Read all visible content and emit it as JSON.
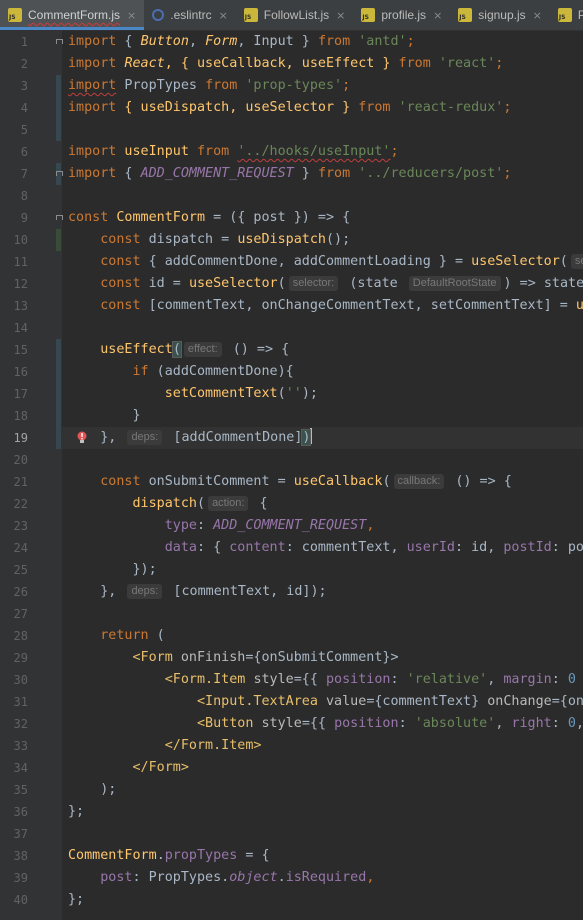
{
  "tabs": [
    {
      "label": "CommentForm.js",
      "icon": "js-file-icon",
      "active": true
    },
    {
      "label": ".eslintrc",
      "icon": "eslint-icon",
      "active": false
    },
    {
      "label": "FollowList.js",
      "icon": "js-file-icon",
      "active": false
    },
    {
      "label": "profile.js",
      "icon": "js-file-icon",
      "active": false
    },
    {
      "label": "signup.js",
      "icon": "js-file-icon",
      "active": false
    },
    {
      "label": "Po",
      "icon": "js-file-icon",
      "active": false
    }
  ],
  "js_badge": "JS",
  "close_glyph": "×",
  "line_numbers": [
    "1",
    "2",
    "3",
    "4",
    "5",
    "6",
    "7",
    "8",
    "9",
    "10",
    "11",
    "12",
    "13",
    "14",
    "15",
    "16",
    "17",
    "18",
    "19",
    "20",
    "21",
    "22",
    "23",
    "24",
    "25",
    "26",
    "27",
    "28",
    "29",
    "30",
    "31",
    "32",
    "33",
    "34",
    "35",
    "36",
    "37",
    "38",
    "39",
    "40"
  ],
  "current_line": "19",
  "hints": {
    "selector": "selector:",
    "state_type": "DefaultRootState",
    "effect": "effect:",
    "deps": "deps:",
    "callback": "callback:",
    "action": "action:",
    "se": "se"
  },
  "code": {
    "l1": [
      "import",
      " { ",
      "Button",
      ", ",
      "Form",
      ", Input } ",
      "from",
      " ",
      "'antd'",
      ";"
    ],
    "l2": [
      "import",
      " ",
      "React",
      ", { useCallback, useEffect } ",
      "from",
      " ",
      "'react'",
      ";"
    ],
    "l3": [
      "import",
      " PropTypes ",
      "from",
      " ",
      "'prop-types'",
      ";"
    ],
    "l4": [
      "import",
      " { useDispatch, useSelector } ",
      "from",
      " ",
      "'react-redux'",
      ";"
    ],
    "l6": [
      "import",
      " useInput ",
      "from",
      " ",
      "'../hooks/useInput'",
      ";"
    ],
    "l7": [
      "import",
      " { ",
      "ADD_COMMENT_REQUEST",
      " } ",
      "from",
      " ",
      "'../reducers/post'",
      ";"
    ],
    "l9": [
      "const",
      " ",
      "CommentForm",
      " = ({ post }) => {"
    ],
    "l10": [
      "const",
      " dispatch = ",
      "useDispatch",
      "();"
    ],
    "l11": [
      "const",
      " { addCommentDone, addCommentLoading } = ",
      "useSelector",
      "("
    ],
    "l12": [
      "const",
      " id = ",
      "useSelector",
      "(",
      " (state ",
      ") => state"
    ],
    "l13": [
      "const",
      " [commentText, onChangeCommentText, setCommentText] = ",
      "us"
    ],
    "l15": [
      "useEffect",
      "(",
      " () => {"
    ],
    "l16": [
      "if",
      " (addCommentDone){"
    ],
    "l17": [
      "setCommentText",
      "(",
      "''",
      ");"
    ],
    "l18": [
      "}"
    ],
    "l19": [
      "}, ",
      " [addCommentDone]",
      ")"
    ],
    "l21": [
      "const",
      " onSubmitComment = ",
      "useCallback",
      "(",
      " () => {"
    ],
    "l22": [
      "dispatch",
      "(",
      " {"
    ],
    "l23": [
      "type",
      ": ",
      "ADD_COMMENT_REQUEST",
      ","
    ],
    "l24": [
      "data",
      ": { ",
      "content",
      ": commentText, ",
      "userId",
      ": id, ",
      "postId",
      ": pos"
    ],
    "l25": [
      "});"
    ],
    "l26": [
      "}, ",
      " [commentText, id]);"
    ],
    "l28": [
      "return",
      " ("
    ],
    "l29": [
      "<Form ",
      "onFinish",
      "={onSubmitComment}>"
    ],
    "l30": [
      "<Form.Item ",
      "style",
      "={{ ",
      "position",
      ": ",
      "'relative'",
      ", ",
      "margin",
      ": ",
      "0",
      " }"
    ],
    "l31": [
      "<Input.TextArea ",
      "value",
      "={commentText} ",
      "onChange",
      "={onC"
    ],
    "l32": [
      "<Button ",
      "style",
      "={{ ",
      "position",
      ": ",
      "'absolute'",
      ", ",
      "right",
      ": ",
      "0",
      ","
    ],
    "l33": [
      "</Form.Item>"
    ],
    "l34": [
      "</Form>"
    ],
    "l35": [
      ");"
    ],
    "l36": [
      "};"
    ],
    "l38": [
      "CommentForm",
      ".",
      "propTypes",
      " = {"
    ],
    "l39": [
      "post",
      ": PropTypes.",
      "object",
      ".",
      "isRequired",
      ","
    ],
    "l40": [
      "};"
    ]
  },
  "colors": {
    "background": "#2b2b2b",
    "gutter": "#313335",
    "keyword": "#cc7832",
    "string": "#6a8759",
    "function": "#ffc66d",
    "property": "#9876aa",
    "text": "#a9b7c6",
    "tab_active_underline": "#4a88c7",
    "error_wave": "#bc3f3c"
  }
}
